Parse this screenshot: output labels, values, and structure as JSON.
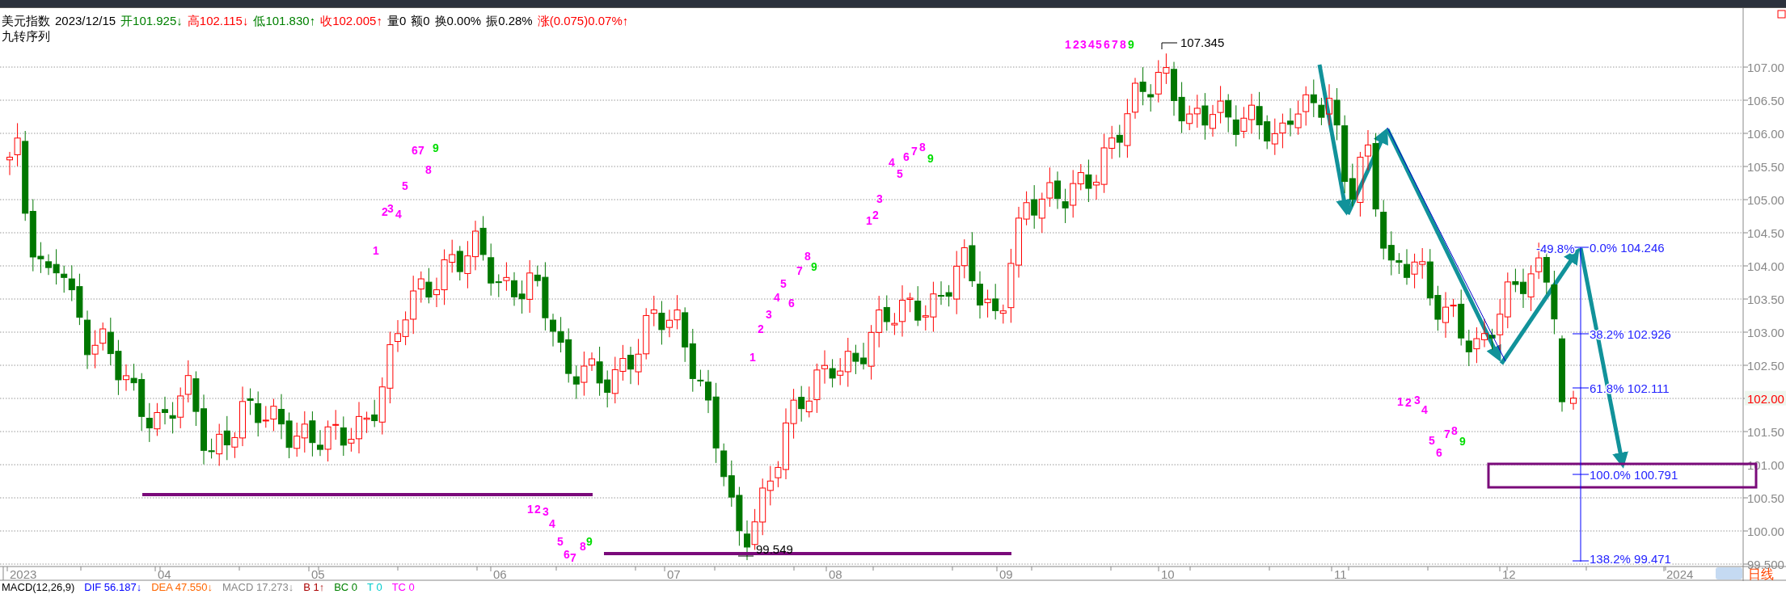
{
  "quote": {
    "items": [
      {
        "label": "美元指数",
        "value": "",
        "color": "#000000"
      },
      {
        "label": "2023/12/15",
        "value": "",
        "color": "#000000"
      },
      {
        "label": "开",
        "value": "101.925↓",
        "color": "#008000"
      },
      {
        "label": "高",
        "value": "102.115↓",
        "color": "#ff0000"
      },
      {
        "label": "低",
        "value": "101.830↑",
        "color": "#008000"
      },
      {
        "label": "收",
        "value": "102.005↑",
        "color": "#ff0000"
      },
      {
        "label": "量0",
        "value": "",
        "color": "#000000"
      },
      {
        "label": "额0",
        "value": "",
        "color": "#000000"
      },
      {
        "label": "换0.00%",
        "value": "",
        "color": "#000000"
      },
      {
        "label": "振0.28%",
        "value": "",
        "color": "#000000"
      },
      {
        "label": "涨(0.075)0.07%↑",
        "value": "",
        "color": "#ff0000"
      }
    ],
    "indicator": "九转序列"
  },
  "chart": {
    "price_labels": [
      "107.00",
      "106.50",
      "106.00",
      "105.50",
      "105.00",
      "104.50",
      "104.00",
      "103.50",
      "103.00",
      "102.50",
      "101.50",
      "101.00",
      "100.50",
      "100.00",
      "99.500"
    ],
    "current_price": "102.00",
    "month_labels": [
      "2023",
      "04",
      "05",
      "06",
      "07",
      "08",
      "09",
      "10",
      "11",
      "12",
      "2024"
    ],
    "period": "日线",
    "high_label": "107.345",
    "low_label": "99.549",
    "fib_labels": [
      "-49.8%",
      "0.0% 104.246",
      "38.2% 102.926",
      "61.8% 102.111",
      "100.0% 100.791",
      "138.2% 99.471"
    ],
    "sequences": [
      [
        {
          "text": "1",
          "color": "#ff00ff"
        },
        {
          "text": "2",
          "color": "#ff00ff"
        },
        {
          "text": "3",
          "color": "#ff00ff"
        },
        {
          "text": "4",
          "color": "#ff00ff"
        },
        {
          "text": "5",
          "color": "#ff00ff"
        },
        {
          "text": "6",
          "color": "#ff00ff"
        },
        {
          "text": "7",
          "color": "#ff00ff"
        },
        {
          "text": "8",
          "color": "#ff00ff"
        },
        {
          "text": "9",
          "color": "#00dd00"
        }
      ],
      [
        {
          "text": "1",
          "color": "#ff00ff"
        },
        {
          "text": "2",
          "color": "#ff00ff"
        },
        {
          "text": "3",
          "color": "#ff00ff"
        },
        {
          "text": "4",
          "color": "#ff00ff"
        },
        {
          "text": "5",
          "color": "#ff00ff"
        },
        {
          "text": "6",
          "color": "#ff00ff"
        },
        {
          "text": "7",
          "color": "#ff00ff"
        },
        {
          "text": "8",
          "color": "#ff00ff"
        },
        {
          "text": "9",
          "color": "#00dd00"
        }
      ],
      [
        {
          "text": "1",
          "color": "#ff00ff"
        },
        {
          "text": "2",
          "color": "#ff00ff"
        },
        {
          "text": "3",
          "color": "#ff00ff"
        },
        {
          "text": "4",
          "color": "#ff00ff"
        },
        {
          "text": "5",
          "color": "#ff00ff"
        },
        {
          "text": "6",
          "color": "#ff00ff"
        },
        {
          "text": "7",
          "color": "#ff00ff"
        },
        {
          "text": "8",
          "color": "#ff00ff"
        },
        {
          "text": "9",
          "color": "#00dd00"
        }
      ],
      [
        {
          "text": "1",
          "color": "#ff00ff"
        },
        {
          "text": "2",
          "color": "#ff00ff"
        },
        {
          "text": "3",
          "color": "#ff00ff"
        },
        {
          "text": "4",
          "color": "#ff00ff"
        },
        {
          "text": "5",
          "color": "#ff00ff"
        },
        {
          "text": "6",
          "color": "#ff00ff"
        },
        {
          "text": "7",
          "color": "#ff00ff"
        },
        {
          "text": "8",
          "color": "#ff00ff"
        },
        {
          "text": "9",
          "color": "#00dd00"
        }
      ],
      [
        {
          "text": "1",
          "color": "#ff00ff"
        },
        {
          "text": "2",
          "color": "#ff00ff"
        },
        {
          "text": "3",
          "color": "#ff00ff"
        },
        {
          "text": "4",
          "color": "#ff00ff"
        },
        {
          "text": "5",
          "color": "#ff00ff"
        },
        {
          "text": "6",
          "color": "#ff00ff"
        },
        {
          "text": "7",
          "color": "#ff00ff"
        },
        {
          "text": "8",
          "color": "#ff00ff"
        },
        {
          "text": "9",
          "color": "#00dd00"
        }
      ],
      [
        {
          "text": "1",
          "color": "#ff00ff"
        },
        {
          "text": "2",
          "color": "#ff00ff"
        },
        {
          "text": "3",
          "color": "#ff00ff"
        },
        {
          "text": "4",
          "color": "#ff00ff"
        },
        {
          "text": "5",
          "color": "#ff00ff"
        },
        {
          "text": "6",
          "color": "#ff00ff"
        },
        {
          "text": "7",
          "color": "#ff00ff"
        },
        {
          "text": "8",
          "color": "#ff00ff"
        },
        {
          "text": "9",
          "color": "#00dd00"
        }
      ]
    ]
  },
  "macd": {
    "title": "MACD(12,26,9)",
    "items": [
      {
        "label": "DIF",
        "value": "56.187↓",
        "color": "#0000ff"
      },
      {
        "label": "DEA",
        "value": "47.550↓",
        "color": "#ff6600"
      },
      {
        "label": "MACD",
        "value": "17.273↓",
        "color": "#888888"
      },
      {
        "label": "B",
        "value": "1↑",
        "color": "#aa0000"
      },
      {
        "label": "BC",
        "value": "0",
        "color": "#008000"
      },
      {
        "label": "T",
        "value": "0",
        "color": "#00cccc"
      },
      {
        "label": "TC",
        "value": "0",
        "color": "#ff00ff"
      }
    ]
  }
}
